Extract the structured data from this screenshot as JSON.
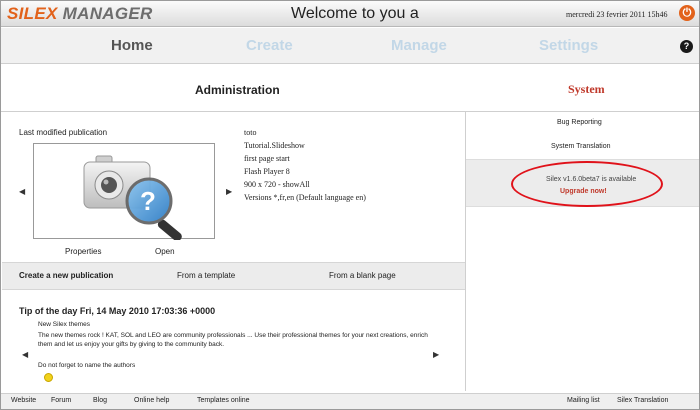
{
  "app": {
    "logo_part1": "SILEX",
    "logo_part2": "MANAGER",
    "welcome": "Welcome to you a",
    "date": "mercredi 23 fevrier 2011 15h46",
    "power_icon": "power-icon",
    "help_icon": "help-icon",
    "accent_color": "#e2621b"
  },
  "nav": {
    "home": "Home",
    "create": "Create",
    "manage": "Manage",
    "settings": "Settings"
  },
  "admin": {
    "title": "Administration",
    "last_modified_label": "Last modified publication",
    "properties": "Properties",
    "open": "Open",
    "info": [
      "toto",
      "Tutorial.Slideshow",
      "first page start",
      "Flash Player 8",
      "900 x 720  - showAll",
      "Versions *,fr,en (Default language en)"
    ],
    "create_new": "Create a new publication",
    "from_template": "From a template",
    "from_blank": "From a blank page",
    "tip_title": "Tip of the day Fri, 14 May 2010 17:03:36 +0000",
    "tip_heading": "New Silex themes",
    "tip_body": "The new themes rock ! KAT, SOL and LEO are community professionals ... Use their professional themes for your next creations, enrich them and let us enjoy your gifts by giving to the community back.",
    "tip_footer": "Do not forget to name the authors"
  },
  "system": {
    "title": "System",
    "bug_reporting": "Bug Reporting",
    "system_translation": "System Translation",
    "update_text": "Silex v1.6.0beta7 is available",
    "upgrade_now": "Upgrade now!"
  },
  "footer": {
    "left": [
      "Website",
      "Forum",
      "Blog",
      "Online help",
      "Templates online"
    ],
    "right": [
      "Mailing list",
      "Silex Translation"
    ]
  }
}
